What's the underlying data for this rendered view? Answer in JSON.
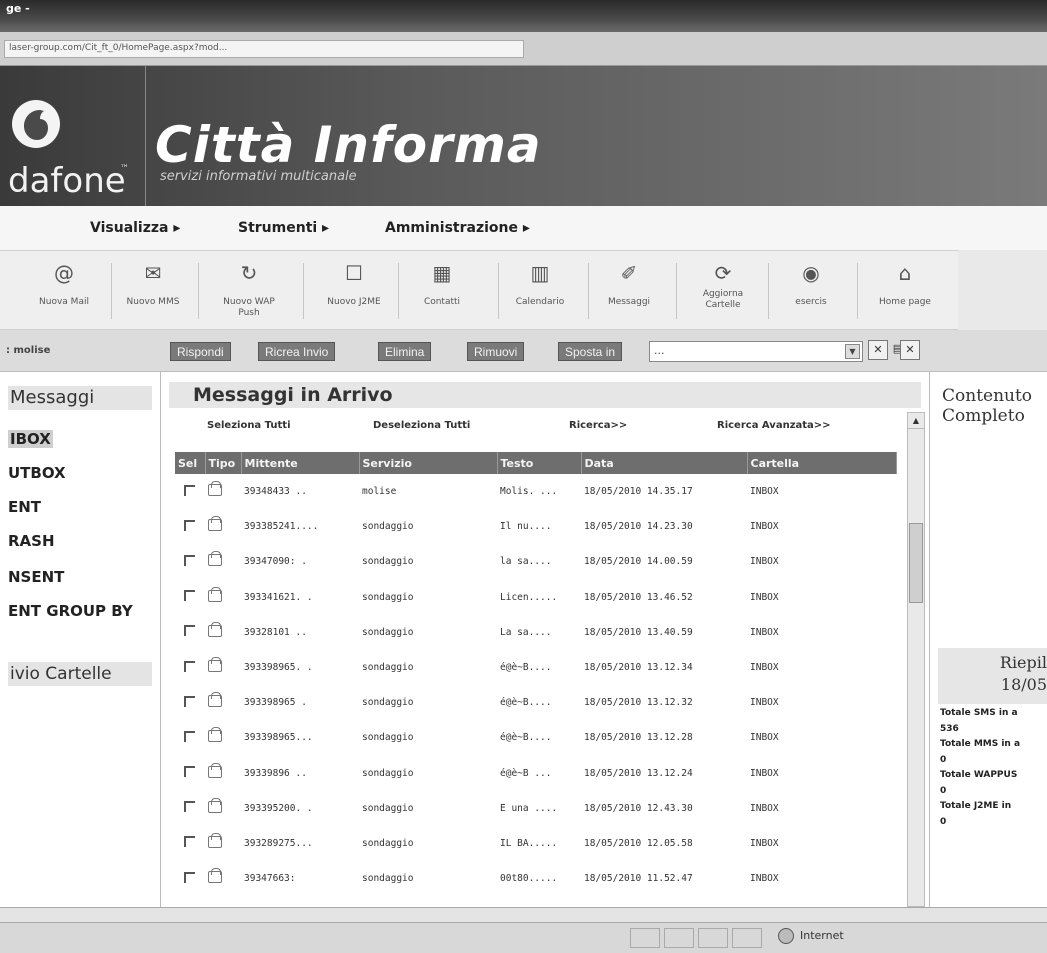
{
  "browser": {
    "title": "ge -",
    "url": "laser-group.com/Cit_ft_0/HomePage.aspx?mod..."
  },
  "banner": {
    "logo_text": "dafone",
    "logo_tm": "™",
    "title": "Città Informa",
    "subtitle": "servizi informativi multicanale"
  },
  "menu": {
    "items": [
      "Visualizza ▸",
      "Strumenti ▸",
      "Amministrazione ▸"
    ]
  },
  "toolbar": {
    "tools": [
      {
        "icon": "@",
        "label": "Nuova Mail"
      },
      {
        "icon": "✉",
        "label": "Nuovo MMS"
      },
      {
        "icon": "↻",
        "label": "Nuovo WAP Push"
      },
      {
        "icon": "☐",
        "label": "Nuovo J2ME"
      },
      {
        "icon": "▦",
        "label": "Contatti"
      },
      {
        "icon": "▥",
        "label": "Calendario"
      },
      {
        "icon": "✐",
        "label": "Messaggi"
      },
      {
        "icon": "⟳",
        "label": "Aggiorna Cartelle"
      },
      {
        "icon": "◉",
        "label": "esercis"
      },
      {
        "icon": "⌂",
        "label": "Home page"
      }
    ]
  },
  "actionbar": {
    "area_label": ": molise",
    "buttons": [
      "Rispondi",
      "Ricrea Invio",
      "Elimina",
      "Rimuovi",
      "Sposta in"
    ],
    "move_select_value": "...",
    "icon_clear": "✕",
    "icon_export": "▤",
    "icon_close": "✕"
  },
  "sidebar": {
    "title": "Messaggi",
    "folders": [
      "IBOX",
      "UTBOX",
      "ENT",
      "RASH",
      "NSENT",
      "ENT GROUP BY"
    ],
    "archive": "ivio Cartelle"
  },
  "main": {
    "title": "Messaggi in Arrivo",
    "links": [
      "Seleziona Tutti",
      "Deseleziona Tutti",
      "Ricerca>>",
      "Ricerca Avanzata>>"
    ],
    "columns": [
      "Sel",
      "Tipo",
      "Mittente",
      "Servizio",
      "Testo",
      "Data",
      "Cartella"
    ],
    "rows": [
      {
        "sender": "39348433 ..",
        "service": "molise",
        "text": "Molis. ...",
        "date": "18/05/2010 14.35.17",
        "folder": "INBOX"
      },
      {
        "sender": "393385241....",
        "service": "sondaggio",
        "text": "Il nu....",
        "date": "18/05/2010 14.23.30",
        "folder": "INBOX"
      },
      {
        "sender": "39347090: .",
        "service": "sondaggio",
        "text": "la sa....",
        "date": "18/05/2010 14.00.59",
        "folder": "INBOX"
      },
      {
        "sender": "393341621. .",
        "service": "sondaggio",
        "text": "Licen.....",
        "date": "18/05/2010 13.46.52",
        "folder": "INBOX"
      },
      {
        "sender": "39328101 ..",
        "service": "sondaggio",
        "text": "La sa....",
        "date": "18/05/2010 13.40.59",
        "folder": "INBOX"
      },
      {
        "sender": "393398965. .",
        "service": "sondaggio",
        "text": "é@è~B....",
        "date": "18/05/2010 13.12.34",
        "folder": "INBOX"
      },
      {
        "sender": "393398965 .",
        "service": "sondaggio",
        "text": "é@è~B....",
        "date": "18/05/2010 13.12.32",
        "folder": "INBOX"
      },
      {
        "sender": "393398965...",
        "service": "sondaggio",
        "text": "é@è~B....",
        "date": "18/05/2010 13.12.28",
        "folder": "INBOX"
      },
      {
        "sender": "39339896 ..",
        "service": "sondaggio",
        "text": "é@è~B ...",
        "date": "18/05/2010 13.12.24",
        "folder": "INBOX"
      },
      {
        "sender": "393395200. .",
        "service": "sondaggio",
        "text": "E una ....",
        "date": "18/05/2010 12.43.30",
        "folder": "INBOX"
      },
      {
        "sender": "393289275...",
        "service": "sondaggio",
        "text": "IL BA.....",
        "date": "18/05/2010 12.05.58",
        "folder": "INBOX"
      },
      {
        "sender": "39347663:",
        "service": "sondaggio",
        "text": "00t80.....",
        "date": "18/05/2010 11.52.47",
        "folder": "INBOX"
      }
    ]
  },
  "right": {
    "title_line1": "Contenuto",
    "title_line2": "Completo",
    "summary_line1": "Riepil",
    "summary_line2": "18/05",
    "stats": [
      {
        "label": "Totale SMS in a",
        "value": "536"
      },
      {
        "label": "Totale MMS in a",
        "value": "0"
      },
      {
        "label": "Totale WAPPUS",
        "value": "0"
      },
      {
        "label": "Totale J2ME in",
        "value": "0"
      }
    ]
  },
  "statusbar": {
    "zone": "Internet"
  },
  "colors": {
    "banner": "#4a4a4a",
    "header_row": "#6e6e6e",
    "button": "#7a7a7a"
  }
}
